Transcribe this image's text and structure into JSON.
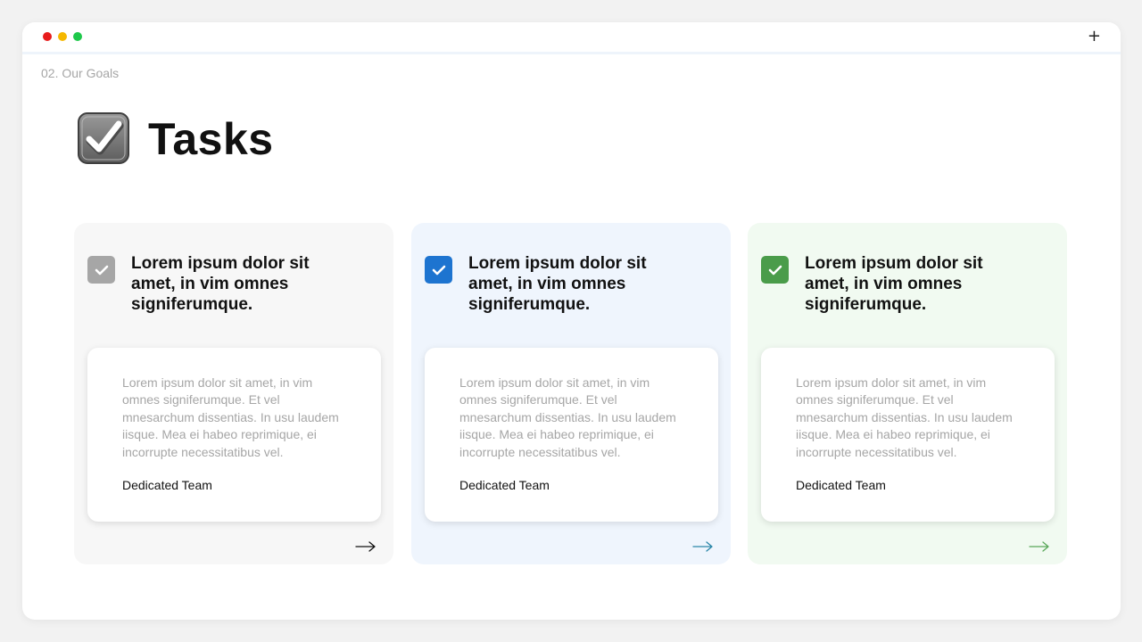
{
  "window": {
    "controls": {
      "red": "#e81c1c",
      "yellow": "#f5b800",
      "green": "#1ec84a"
    },
    "plus_label": "+"
  },
  "breadcrumb": "02. Our Goals",
  "page_title": "Tasks",
  "title_icon": "checkbox-checked-icon",
  "cards": [
    {
      "heading": "Lorem ipsum dolor sit amet, in vim omnes signiferumque.",
      "body": "Lorem ipsum dolor sit amet, in vim omnes signiferumque. Et vel mnesarchum dissentias. In usu laudem iisque. Mea ei habeo reprimique, ei incorrupte necessitatibus vel.",
      "label": "Dedicated Team",
      "background": "#f7f7f7",
      "accent": "#a6a6a6",
      "arrow_color": "#111111"
    },
    {
      "heading": "Lorem ipsum dolor sit amet, in vim omnes signiferumque.",
      "body": "Lorem ipsum dolor sit amet, in vim omnes signiferumque. Et vel mnesarchum dissentias. In usu laudem iisque. Mea ei habeo reprimique, ei incorrupte necessitatibus vel.",
      "label": "Dedicated Team",
      "background": "#eff5fd",
      "accent": "#1d74d0",
      "arrow_color": "#2a86a8"
    },
    {
      "heading": "Lorem ipsum dolor sit amet, in vim omnes signiferumque.",
      "body": "Lorem ipsum dolor sit amet, in vim omnes signiferumque. Et vel mnesarchum dissentias. In usu laudem iisque. Mea ei habeo reprimique, ei incorrupte necessitatibus vel.",
      "label": "Dedicated Team",
      "background": "#f1faf1",
      "accent": "#4a9c4a",
      "arrow_color": "#5aa85a"
    }
  ]
}
